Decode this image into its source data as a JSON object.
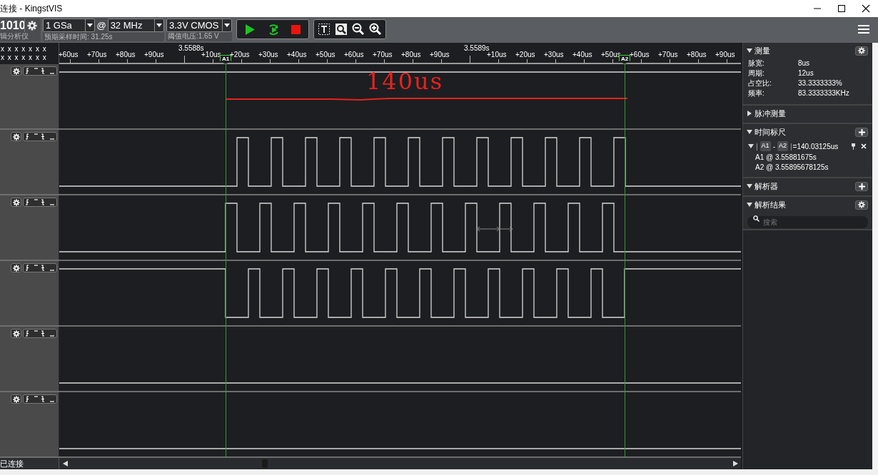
{
  "window": {
    "title": "连接 - KingstVIS"
  },
  "toolbar": {
    "logo": "1010",
    "device_label": "辑分析仪",
    "sample_depth": "1 GSa",
    "at": "@",
    "sample_rate": "32 MHz",
    "expected_time": "预期采样时间: 31.25s",
    "voltage": "3.3V CMOS",
    "threshold": "阈值电压:1.65 V"
  },
  "ruler": {
    "channel_marks": [
      "x x x x x x x",
      "x x x x x x x"
    ],
    "ticks": [
      {
        "label": "+60us",
        "kind": "minor"
      },
      {
        "label": "+70us",
        "kind": "minor"
      },
      {
        "label": "+80us",
        "kind": "minor"
      },
      {
        "label": "+90us",
        "kind": "minor"
      },
      {
        "label": "3.5588s",
        "kind": "major"
      },
      {
        "label": "+10us",
        "kind": "minor"
      },
      {
        "label": "+20us",
        "kind": "minor"
      },
      {
        "label": "+30us",
        "kind": "minor"
      },
      {
        "label": "+40us",
        "kind": "minor"
      },
      {
        "label": "+50us",
        "kind": "minor"
      },
      {
        "label": "+60us",
        "kind": "minor"
      },
      {
        "label": "+70us",
        "kind": "minor"
      },
      {
        "label": "+80us",
        "kind": "minor"
      },
      {
        "label": "+90us",
        "kind": "minor"
      },
      {
        "label": "3.5589s",
        "kind": "major"
      },
      {
        "label": "+10us",
        "kind": "minor"
      },
      {
        "label": "+20us",
        "kind": "minor"
      },
      {
        "label": "+30us",
        "kind": "minor"
      },
      {
        "label": "+40us",
        "kind": "minor"
      },
      {
        "label": "+50us",
        "kind": "minor"
      },
      {
        "label": "+60us",
        "kind": "minor"
      },
      {
        "label": "+70us",
        "kind": "minor"
      },
      {
        "label": "+80us",
        "kind": "minor"
      },
      {
        "label": "+90us",
        "kind": "minor"
      }
    ],
    "cursors": [
      {
        "label": "A1"
      },
      {
        "label": "A2"
      }
    ]
  },
  "channels": [
    {
      "kind": "high",
      "annotation": {
        "text": "140us",
        "color": "#e8221f"
      }
    },
    {
      "kind": "early"
    },
    {
      "kind": "mid",
      "measure_arrow": true
    },
    {
      "kind": "late"
    },
    {
      "kind": "low"
    },
    {
      "kind": "low"
    }
  ],
  "panel": [
    {
      "kind": "measure",
      "title": "测量",
      "expanded": true,
      "button": {
        "kind": "settings"
      },
      "rows": [
        {
          "label": "脉宽:",
          "value": "8us"
        },
        {
          "label": "周期:",
          "value": "12us"
        },
        {
          "label": "占空比:",
          "value": "33.3333333%"
        },
        {
          "label": "频率:",
          "value": "83.3333333KHz"
        }
      ]
    },
    {
      "kind": "plain",
      "title": "脉冲测量",
      "expanded": false
    },
    {
      "kind": "cursors",
      "title": "时间标尺",
      "expanded": true,
      "button": {
        "kind": "add"
      },
      "pair": {
        "expanded": true,
        "open": "|",
        "a": "A1",
        "sep": "-",
        "b": "A2",
        "close": "|",
        "value": "=140.03125us"
      },
      "lines": [
        "A1 @ 3.55881675s",
        "A2 @ 3.55895678125s"
      ]
    },
    {
      "kind": "plain",
      "title": "解析器",
      "expanded": true,
      "button": {
        "kind": "add"
      }
    },
    {
      "kind": "search",
      "title": "解析结果",
      "expanded": true,
      "button": {
        "kind": "settings"
      },
      "placeholder": "搜索"
    }
  ],
  "status": "已连接"
}
